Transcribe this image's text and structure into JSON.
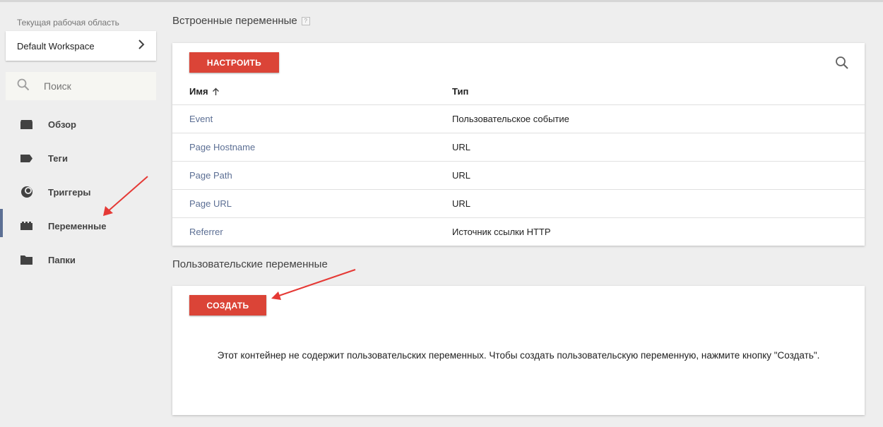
{
  "sidebar": {
    "workspace_label": "Текущая рабочая область",
    "workspace_name": "Default Workspace",
    "search_placeholder": "Поиск",
    "items": [
      {
        "label": "Обзор",
        "icon": "overview-icon"
      },
      {
        "label": "Теги",
        "icon": "tag-icon"
      },
      {
        "label": "Триггеры",
        "icon": "trigger-icon"
      },
      {
        "label": "Переменные",
        "icon": "variables-icon",
        "active": true
      },
      {
        "label": "Папки",
        "icon": "folder-icon"
      }
    ]
  },
  "builtin": {
    "title": "Встроенные переменные",
    "help": "?",
    "configure_label": "НАСТРОИТЬ",
    "columns": {
      "name": "Имя",
      "type": "Тип"
    },
    "rows": [
      {
        "name": "Event",
        "type": "Пользовательское событие"
      },
      {
        "name": "Page Hostname",
        "type": "URL"
      },
      {
        "name": "Page Path",
        "type": "URL"
      },
      {
        "name": "Page URL",
        "type": "URL"
      },
      {
        "name": "Referrer",
        "type": "Источник ссылки HTTP"
      }
    ]
  },
  "custom": {
    "title": "Пользовательские переменные",
    "create_label": "СОЗДАТЬ",
    "empty_message": "Этот контейнер не содержит пользовательских переменных. Чтобы создать пользовательскую переменную, нажмите кнопку \"Создать\"."
  },
  "colors": {
    "accent_red": "#db4437",
    "link_blue": "#5c6f94",
    "annotation_arrow": "#e53935"
  }
}
